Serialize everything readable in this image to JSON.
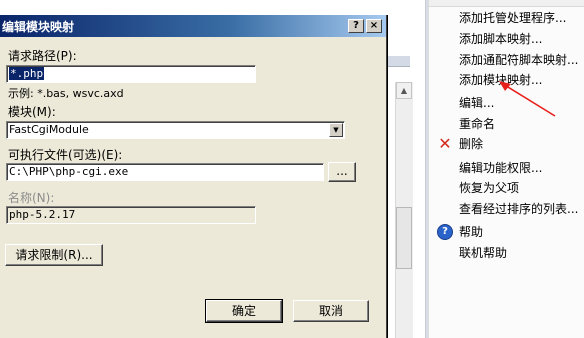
{
  "dialog": {
    "title": "编辑模块映射",
    "help_button": "?",
    "close_button": "×",
    "request_path_label": "请求路径(P):",
    "request_path_value": "*.php",
    "example_text": "示例: *.bas, wsvc.axd",
    "module_label": "模块(M):",
    "module_value": "FastCgiModule",
    "executable_label": "可执行文件(可选)(E):",
    "executable_value": "C:\\PHP\\php-cgi.exe",
    "browse_button": "...",
    "name_label": "名称(N):",
    "name_value": "php-5.2.17",
    "request_restrictions_button": "请求限制(R)...",
    "ok_button": "确定",
    "cancel_button": "取消"
  },
  "actions": {
    "items": [
      {
        "label": "添加托管处理程序..."
      },
      {
        "label": "添加脚本映射..."
      },
      {
        "label": "添加通配符脚本映射..."
      },
      {
        "label": "添加模块映射..."
      },
      {
        "label": "编辑..."
      },
      {
        "label": "重命名"
      },
      {
        "label": "删除",
        "icon": "delete-icon"
      },
      {
        "label": "编辑功能权限..."
      },
      {
        "label": "恢复为父项"
      },
      {
        "label": "查看经过排序的列表..."
      },
      {
        "label": "帮助",
        "icon": "help-icon"
      },
      {
        "label": "联机帮助"
      }
    ]
  },
  "colors": {
    "titlebar_start": "#0a246a",
    "delete_red": "#d42b1c",
    "help_blue": "#2a63c9",
    "annotation_red": "#e8201c"
  }
}
